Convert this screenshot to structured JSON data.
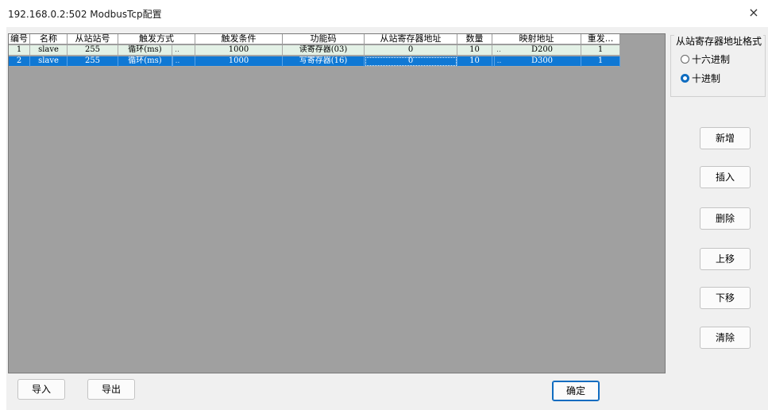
{
  "window": {
    "title": "192.168.0.2:502 ModbusTcp配置",
    "close_label": "×"
  },
  "table": {
    "columns": [
      "编号",
      "名称",
      "从站站号",
      "触发方式",
      "触发条件",
      "功能码",
      "从站寄存器地址",
      "数量",
      "映射地址",
      "重发..."
    ],
    "rows": [
      {
        "no": "1",
        "name": "slave",
        "station": "255",
        "trigger_mode": "循环(ms)",
        "trigger_dd": "..",
        "trigger_cond": "1000",
        "func_code": "读寄存器(03)",
        "reg_addr": "0",
        "count": "10",
        "map_dd": "..",
        "map_addr": "D200",
        "retry": "1"
      },
      {
        "no": "2",
        "name": "slave",
        "station": "255",
        "trigger_mode": "循环(ms)",
        "trigger_dd": "..",
        "trigger_cond": "1000",
        "func_code": "写寄存器(16)",
        "reg_addr": "0",
        "count": "10",
        "map_dd": "..",
        "map_addr": "D300",
        "retry": "1"
      }
    ],
    "selected_row": 2
  },
  "format_group": {
    "title": "从站寄存器地址格式",
    "options": [
      {
        "label": "十六进制",
        "checked": false
      },
      {
        "label": "十进制",
        "checked": true
      }
    ]
  },
  "side_buttons": {
    "add": "新增",
    "insert": "插入",
    "delete": "删除",
    "move_up": "上移",
    "move_down": "下移",
    "clear": "清除"
  },
  "bottom_buttons": {
    "import": "导入",
    "export": "导出",
    "ok": "确定"
  },
  "colors": {
    "selected_row": "#0f78d4",
    "normal_row": "#e3f1e6",
    "grid_background": "#a0a0a0",
    "accent": "#0f6cc0"
  }
}
